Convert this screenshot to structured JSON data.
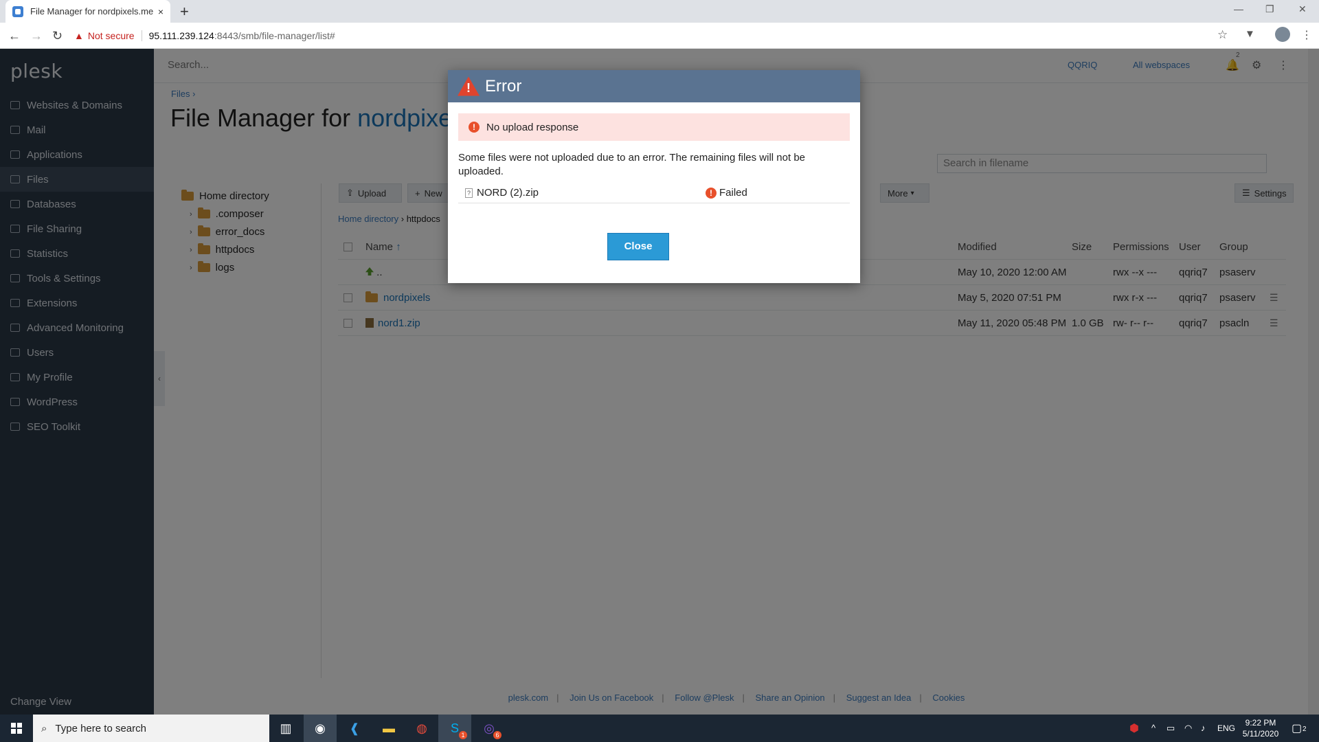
{
  "browser": {
    "tab_title": "File Manager for nordpixels.me",
    "new_tab": "+",
    "close_tab": "×",
    "security_label": "Not secure",
    "url_host": "95.111.239.124",
    "url_path": ":8443/smb/file-manager/list#"
  },
  "sidebar": {
    "logo": "plesk",
    "items": [
      {
        "label": "Websites & Domains"
      },
      {
        "label": "Mail"
      },
      {
        "label": "Applications"
      },
      {
        "label": "Files"
      },
      {
        "label": "Databases"
      },
      {
        "label": "File Sharing"
      },
      {
        "label": "Statistics"
      },
      {
        "label": "Tools & Settings"
      },
      {
        "label": "Extensions"
      },
      {
        "label": "Advanced Monitoring"
      },
      {
        "label": "Users"
      },
      {
        "label": "My Profile"
      },
      {
        "label": "WordPress"
      },
      {
        "label": "SEO Toolkit"
      }
    ],
    "change_view": "Change View"
  },
  "header": {
    "search_placeholder": "Search...",
    "user": "QQRIQ",
    "workspaces": "All webspaces",
    "notification_count": "2"
  },
  "breadcrumb": {
    "label": "Files"
  },
  "page": {
    "title_prefix": "File Manager for ",
    "title_domain": "nordpixels.me"
  },
  "filter": {
    "placeholder": "Search in filename"
  },
  "tree": {
    "root": "Home directory",
    "children": [
      ".composer",
      "error_docs",
      "httpdocs",
      "logs"
    ]
  },
  "toolbar": {
    "upload": "Upload",
    "new": "New",
    "more": "More",
    "settings": "Settings"
  },
  "pathbar": {
    "home": "Home directory",
    "current": "httpdocs"
  },
  "table": {
    "columns": [
      "Name",
      "Modified",
      "Size",
      "Permissions",
      "User",
      "Group"
    ],
    "rows": [
      {
        "name": "..",
        "modified": "May 10, 2020 12:00 AM",
        "size": "",
        "permissions": "rwx --x ---",
        "user": "qqriq7",
        "group": "psaserv"
      },
      {
        "name": "nordpixels",
        "modified": "May 5, 2020 07:51 PM",
        "size": "",
        "permissions": "rwx r-x ---",
        "user": "qqriq7",
        "group": "psaserv"
      },
      {
        "name": "nord1.zip",
        "modified": "May 11, 2020 05:48 PM",
        "size": "1.0 GB",
        "permissions": "rw- r-- r--",
        "user": "qqriq7",
        "group": "psacln"
      }
    ]
  },
  "footer": {
    "links": [
      "plesk.com",
      "Join Us on Facebook",
      "Follow @Plesk",
      "Share an Opinion",
      "Suggest an Idea",
      "Cookies"
    ]
  },
  "dialog": {
    "title": "Error",
    "alert": "No upload response",
    "message": "Some files were not uploaded due to an error. The remaining files will not be uploaded.",
    "file_name": "NORD (2).zip",
    "file_status": "Failed",
    "close_label": "Close"
  },
  "taskbar": {
    "search_placeholder": "Type here to search",
    "lang": "ENG",
    "time": "9:22 PM",
    "date": "5/11/2020",
    "notif_count": "2",
    "badge_skype": "1",
    "badge_viber": "6"
  },
  "colors": {
    "sidebar_bg": "#2b3846",
    "dialog_header": "#5a7391",
    "close_button": "#2b9ad6",
    "alert_bg": "#fde2e0",
    "error_icon": "#e8502b"
  }
}
